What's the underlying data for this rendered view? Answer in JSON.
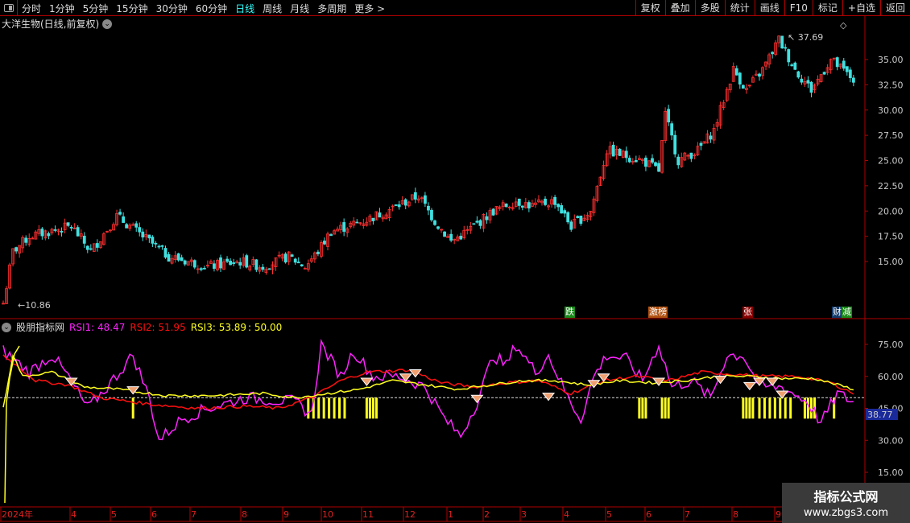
{
  "toolbar": {
    "periods": [
      "分时",
      "1分钟",
      "5分钟",
      "15分钟",
      "30分钟",
      "60分钟",
      "日线",
      "周线",
      "月线",
      "多周期",
      "更多 >"
    ],
    "active": "日线",
    "actions": [
      "复权",
      "叠加",
      "多股",
      "统计",
      "画线",
      "F10",
      "标记",
      "+自选",
      "返回"
    ]
  },
  "title": "大洋生物(日线,前复权)",
  "price_axis": [
    "35.00",
    "32.50",
    "30.00",
    "27.50",
    "25.00",
    "22.50",
    "20.00",
    "17.50",
    "15.00"
  ],
  "high_label": "37.69",
  "low_label": "10.86",
  "event_tags": [
    {
      "text": "跌",
      "color": "#1a8a1a"
    },
    {
      "text": "激榜",
      "color": "#b05010"
    },
    {
      "text": "张",
      "color": "#8a0000"
    },
    {
      "text": "财",
      "color": "#123a6a"
    },
    {
      "text": "减",
      "color": "#1a8a1a"
    }
  ],
  "indicator": {
    "name": "股朋指标网",
    "rsi1_label": "RSI1: 48.47",
    "rsi2_label": "RSI2: 51.95",
    "rsi3_label": "RSI3: 53.89",
    "level_label": ": 50.00",
    "axis": [
      "75.00",
      "60.00",
      "45.00",
      "30.00",
      "15.00"
    ],
    "current_value": "38.77",
    "colors": {
      "rsi1": "#ff22ff",
      "rsi2": "#ff1010",
      "rsi3": "#ffff20"
    }
  },
  "date_axis": [
    "2024年",
    "4",
    "5",
    "6",
    "7",
    "8",
    "9",
    "10",
    "11",
    "12",
    "1",
    "2",
    "3",
    "4",
    "5",
    "6",
    "7",
    "8",
    "9"
  ],
  "watermark": {
    "line1": "指标公式网",
    "line2": "www.zbgs3.com"
  },
  "chart_data": {
    "type": "candlestick",
    "price_keypoints": [
      [
        0,
        10.86
      ],
      [
        3,
        16
      ],
      [
        8,
        17.5
      ],
      [
        21,
        18.5
      ],
      [
        27,
        16
      ],
      [
        35,
        19.5
      ],
      [
        43,
        17.5
      ],
      [
        51,
        15.5
      ],
      [
        63,
        14.5
      ],
      [
        73,
        15
      ],
      [
        80,
        14.5
      ],
      [
        88,
        15.5
      ],
      [
        93,
        14.5
      ],
      [
        97,
        16
      ],
      [
        101,
        18
      ],
      [
        111,
        19
      ],
      [
        118,
        20
      ],
      [
        128,
        21.5
      ],
      [
        133,
        19
      ],
      [
        138,
        17
      ],
      [
        143,
        18
      ],
      [
        151,
        20
      ],
      [
        158,
        21
      ],
      [
        163,
        20.5
      ],
      [
        170,
        21
      ],
      [
        175,
        18.5
      ],
      [
        181,
        20
      ],
      [
        186,
        26
      ],
      [
        197,
        25
      ],
      [
        202,
        24
      ],
      [
        204,
        29.5
      ],
      [
        208,
        25
      ],
      [
        214,
        26
      ],
      [
        219,
        28
      ],
      [
        225,
        34
      ],
      [
        229,
        32
      ],
      [
        234,
        34
      ],
      [
        239,
        37
      ],
      [
        244,
        34
      ],
      [
        249,
        32
      ],
      [
        255,
        35
      ],
      [
        262,
        33
      ]
    ],
    "rsi1_keypoints": [
      [
        0,
        72
      ],
      [
        8,
        62
      ],
      [
        15,
        70
      ],
      [
        20,
        60
      ],
      [
        26,
        45
      ],
      [
        32,
        55
      ],
      [
        40,
        70
      ],
      [
        45,
        50
      ],
      [
        48,
        30
      ],
      [
        55,
        40
      ],
      [
        63,
        45
      ],
      [
        75,
        50
      ],
      [
        90,
        48
      ],
      [
        95,
        42
      ],
      [
        98,
        75
      ],
      [
        104,
        60
      ],
      [
        108,
        72
      ],
      [
        114,
        60
      ],
      [
        122,
        60
      ],
      [
        130,
        55
      ],
      [
        136,
        40
      ],
      [
        141,
        32
      ],
      [
        146,
        48
      ],
      [
        151,
        70
      ],
      [
        155,
        65
      ],
      [
        158,
        75
      ],
      [
        164,
        62
      ],
      [
        168,
        70
      ],
      [
        174,
        50
      ],
      [
        178,
        40
      ],
      [
        182,
        60
      ],
      [
        186,
        70
      ],
      [
        192,
        68
      ],
      [
        197,
        58
      ],
      [
        202,
        75
      ],
      [
        206,
        55
      ],
      [
        212,
        58
      ],
      [
        218,
        50
      ],
      [
        223,
        70
      ],
      [
        228,
        70
      ],
      [
        233,
        55
      ],
      [
        240,
        55
      ],
      [
        248,
        48
      ],
      [
        252,
        38
      ],
      [
        257,
        52
      ],
      [
        262,
        48
      ]
    ],
    "rsi2_keypoints": [
      [
        0,
        70
      ],
      [
        10,
        58
      ],
      [
        20,
        56
      ],
      [
        30,
        50
      ],
      [
        45,
        47
      ],
      [
        60,
        45
      ],
      [
        75,
        46
      ],
      [
        85,
        45
      ],
      [
        95,
        50
      ],
      [
        104,
        58
      ],
      [
        112,
        62
      ],
      [
        125,
        63
      ],
      [
        135,
        57
      ],
      [
        145,
        55
      ],
      [
        155,
        57
      ],
      [
        165,
        58
      ],
      [
        175,
        52
      ],
      [
        185,
        58
      ],
      [
        195,
        60
      ],
      [
        205,
        58
      ],
      [
        215,
        62
      ],
      [
        225,
        61
      ],
      [
        235,
        60
      ],
      [
        245,
        60
      ],
      [
        255,
        57
      ],
      [
        262,
        52
      ]
    ],
    "rsi3_keypoints": [
      [
        0,
        45
      ],
      [
        3,
        70
      ],
      [
        6,
        60
      ],
      [
        15,
        62
      ],
      [
        25,
        55
      ],
      [
        35,
        54
      ],
      [
        50,
        51
      ],
      [
        65,
        51
      ],
      [
        80,
        52
      ],
      [
        90,
        50
      ],
      [
        100,
        52
      ],
      [
        110,
        54
      ],
      [
        120,
        58
      ],
      [
        130,
        56
      ],
      [
        140,
        54
      ],
      [
        150,
        56
      ],
      [
        160,
        58
      ],
      [
        170,
        58
      ],
      [
        180,
        56
      ],
      [
        190,
        58
      ],
      [
        200,
        57
      ],
      [
        210,
        58
      ],
      [
        220,
        60
      ],
      [
        230,
        60
      ],
      [
        240,
        59
      ],
      [
        250,
        59
      ],
      [
        262,
        54
      ]
    ],
    "signal_ranges": [
      [
        40,
        40
      ],
      [
        94,
        106
      ],
      [
        112,
        115
      ],
      [
        233,
        244
      ],
      [
        248,
        250
      ],
      [
        228,
        231
      ],
      [
        256,
        256
      ],
      [
        247,
        247
      ],
      [
        196,
        198
      ],
      [
        203,
        205
      ]
    ],
    "diamonds": [
      [
        21,
        58
      ],
      [
        40,
        54
      ],
      [
        112,
        58
      ],
      [
        124,
        60
      ],
      [
        127,
        62
      ],
      [
        146,
        50
      ],
      [
        168,
        51
      ],
      [
        182,
        57
      ],
      [
        185,
        60
      ],
      [
        202,
        58
      ],
      [
        221,
        59
      ],
      [
        230,
        56
      ],
      [
        233,
        58
      ],
      [
        237,
        58
      ],
      [
        240,
        52
      ]
    ],
    "price_range": [
      8.5,
      39
    ],
    "rsi_range": [
      5,
      80
    ]
  }
}
